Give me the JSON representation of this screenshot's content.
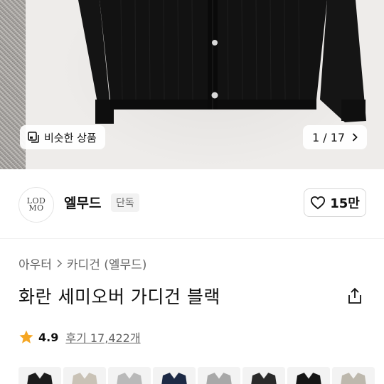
{
  "gallery": {
    "similar_label": "비슷한 상품",
    "counter_current": "1",
    "counter_sep": "/",
    "counter_total": "17"
  },
  "brand": {
    "logo_line1": "LOD",
    "logo_line2": "MO",
    "name": "엘무드",
    "badge": "단독",
    "likes": "15만"
  },
  "breadcrumb": {
    "level1": "아우터",
    "level2": "카디건 (엘무드)"
  },
  "product": {
    "title": "화란 세미오버 가디건 블랙"
  },
  "rating": {
    "score": "4.9",
    "review_label": "후기 17,422개"
  },
  "thumbnails": [
    {
      "color": "black",
      "hex": "#1c1c1c"
    },
    {
      "color": "beige",
      "hex": "#c9c2b6"
    },
    {
      "color": "light-gray",
      "hex": "#b9b9b9"
    },
    {
      "color": "navy",
      "hex": "#1d2a45"
    },
    {
      "color": "gray",
      "hex": "#a8a8a8"
    },
    {
      "color": "charcoal",
      "hex": "#2a2a2a"
    },
    {
      "color": "black",
      "hex": "#151515"
    },
    {
      "color": "oatmeal",
      "hex": "#bdb8ad"
    }
  ],
  "colors": {
    "star": "#f5a623",
    "text_primary": "#111111",
    "text_secondary": "#666666"
  }
}
